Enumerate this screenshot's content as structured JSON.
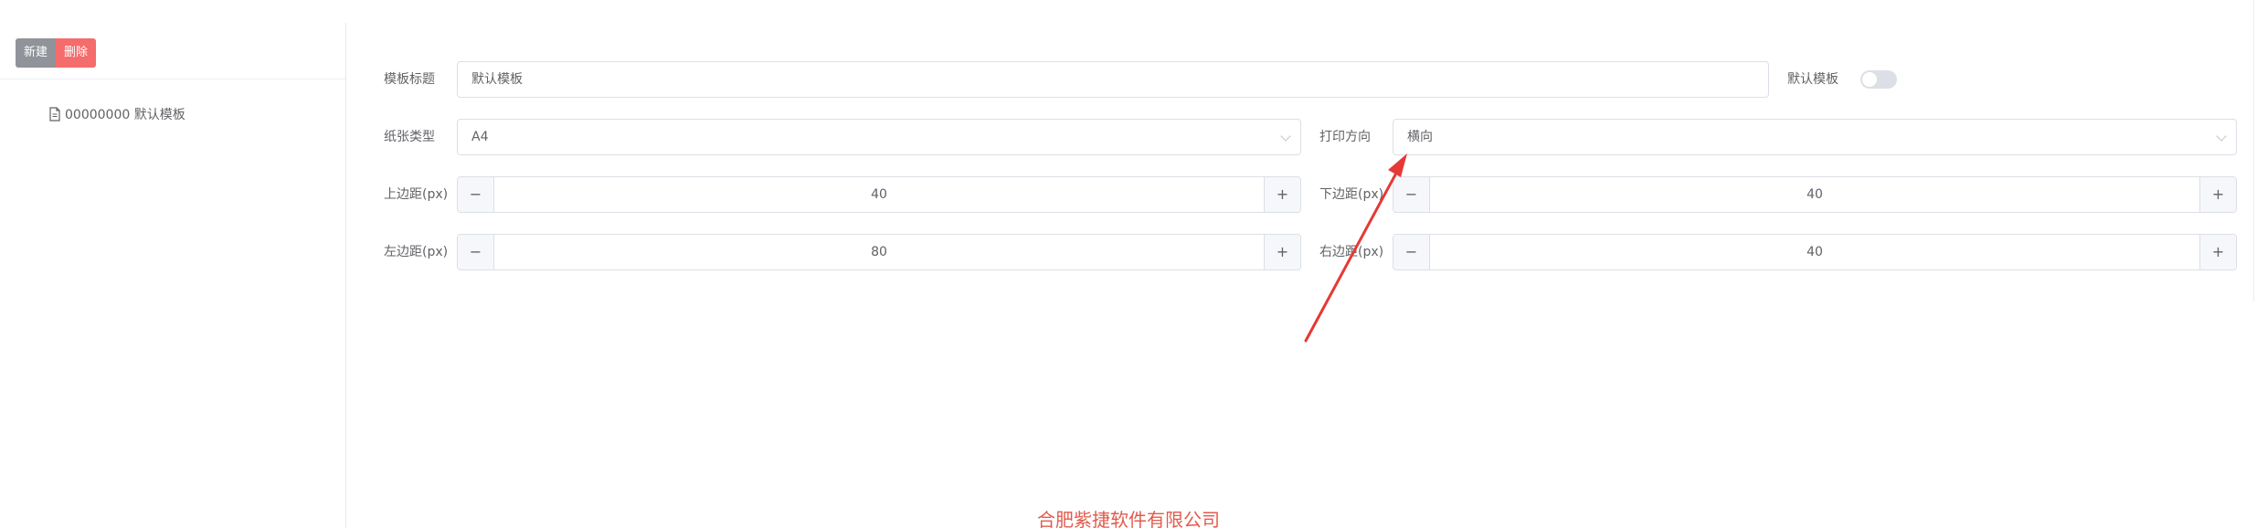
{
  "toolbar": {
    "new_label": "新建",
    "delete_label": "删除"
  },
  "tree": {
    "items": [
      {
        "label": "00000000 默认模板"
      }
    ]
  },
  "form": {
    "template_title": {
      "label": "模板标题",
      "value": "默认模板"
    },
    "default_template": {
      "label": "默认模板",
      "enabled": false
    },
    "paper_type": {
      "label": "纸张类型",
      "value": "A4"
    },
    "print_direction": {
      "label": "打印方向",
      "value": "横向"
    },
    "margin_top": {
      "label": "上边距(px)",
      "value": "40"
    },
    "margin_bottom": {
      "label": "下边距(px)",
      "value": "40"
    },
    "margin_left": {
      "label": "左边距(px)",
      "value": "80"
    },
    "margin_right": {
      "label": "右边距(px)",
      "value": "40"
    },
    "stepper": {
      "minus": "−",
      "plus": "+"
    }
  },
  "footer": {
    "text": "合肥紫捷软件有限公司"
  },
  "colors": {
    "delete": "#f56c6c",
    "new": "#909399",
    "arrow": "#e53935",
    "footer": "#e15b4d"
  }
}
